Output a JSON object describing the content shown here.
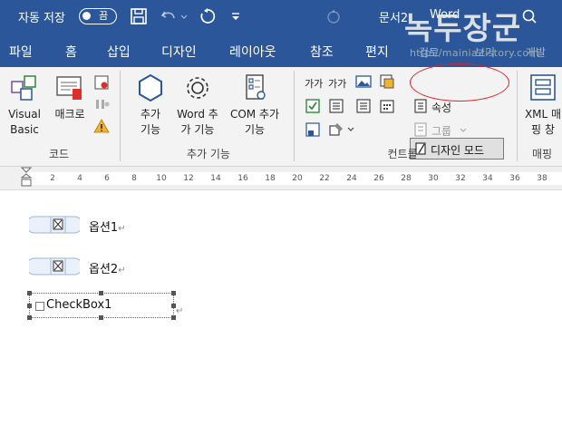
{
  "titlebar": {
    "autosave_label": "자동 저장",
    "toggle_text": "끔",
    "doc_name": "문서2",
    "doc_app": "Word",
    "watermark": "녹두장군",
    "watermark_url": "http://mainia.tistory.com"
  },
  "tabs": [
    {
      "label": "파일"
    },
    {
      "label": "홈"
    },
    {
      "label": "삽입"
    },
    {
      "label": "디자인"
    },
    {
      "label": "레이아웃"
    },
    {
      "label": "참조"
    },
    {
      "label": "편지"
    },
    {
      "label": "검토"
    },
    {
      "label": "보기"
    },
    {
      "label": "개발"
    }
  ],
  "ribbon": {
    "groups": {
      "code": {
        "label": "코드",
        "visual_basic": "Visual Basic",
        "macro": "매크로"
      },
      "addins": {
        "label": "추가 기능",
        "addins_btn": "추가 기능",
        "word_addins": "Word 추가 기능",
        "com_addins": "COM 추가 기능"
      },
      "controls": {
        "label": "컨트롤",
        "design_mode": "디자인 모드",
        "properties": "속성",
        "group": "그룹"
      },
      "mapping": {
        "label": "매핑",
        "xml_pane": "XML 매핑 창"
      }
    },
    "small_labels": {
      "aa1": "가가",
      "aa2": "가가"
    }
  },
  "ruler": {
    "ticks": [
      "2",
      "4",
      "6",
      "8",
      "10",
      "12",
      "14",
      "16",
      "18",
      "20",
      "22",
      "24",
      "26",
      "28",
      "30",
      "32",
      "34",
      "36",
      "38"
    ]
  },
  "document": {
    "option1": "옵션1",
    "option2": "옵션2",
    "checkbox_label": "CheckBox1",
    "para_mark": "↵"
  },
  "colors": {
    "accent": "#2b579a",
    "highlight": "#e0222a"
  }
}
